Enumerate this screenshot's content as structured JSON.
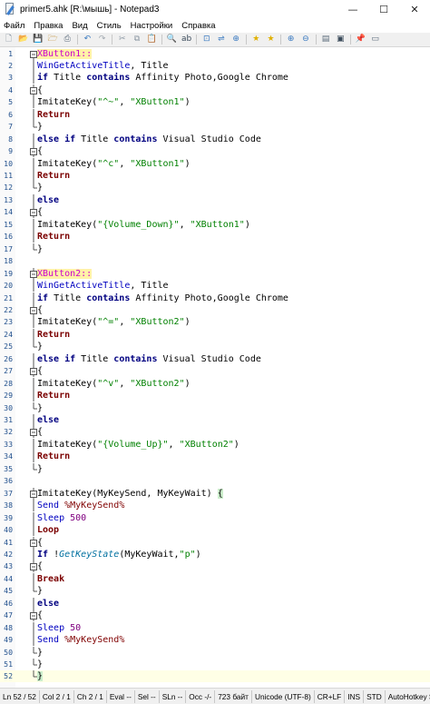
{
  "window": {
    "title": "primer5.ahk [R:\\мышь] - Notepad3"
  },
  "window_controls": {
    "minimize": "—",
    "maximize": "☐",
    "close": "✕"
  },
  "menu": [
    "Файл",
    "Правка",
    "Вид",
    "Стиль",
    "Настройки",
    "Справка"
  ],
  "toolbar": {
    "icons": [
      {
        "name": "new-file-icon",
        "glyph": "🗋",
        "color": "#6a7a8a"
      },
      {
        "name": "open-file-icon",
        "glyph": "📂",
        "color": "#d4a020"
      },
      {
        "name": "save-file-icon",
        "glyph": "💾",
        "color": "#4a6a9a"
      },
      {
        "name": "save-as-icon",
        "glyph": "🗁",
        "color": "#c09030"
      },
      {
        "name": "print-icon",
        "glyph": "⎙",
        "color": "#5a6a7a"
      },
      {
        "name": "sep"
      },
      {
        "name": "undo-icon",
        "glyph": "↶",
        "color": "#3a7ac0"
      },
      {
        "name": "redo-icon",
        "glyph": "↷",
        "color": "#a0a8b0"
      },
      {
        "name": "sep"
      },
      {
        "name": "cut-icon",
        "glyph": "✂",
        "color": "#8a96a2"
      },
      {
        "name": "copy-icon",
        "glyph": "⧉",
        "color": "#8a96a2"
      },
      {
        "name": "paste-icon",
        "glyph": "📋",
        "color": "#c09040"
      },
      {
        "name": "sep"
      },
      {
        "name": "find-icon",
        "glyph": "🔍",
        "color": "#3a4a5a"
      },
      {
        "name": "replace-icon",
        "glyph": "ab",
        "color": "#3a4a5a"
      },
      {
        "name": "sep"
      },
      {
        "name": "goto-icon",
        "glyph": "⊡",
        "color": "#3a7ac0"
      },
      {
        "name": "word-wrap-icon",
        "glyph": "⇌",
        "color": "#3a7ac0"
      },
      {
        "name": "zoom-in-icon",
        "glyph": "⊕",
        "color": "#3a7ac0"
      },
      {
        "name": "sep"
      },
      {
        "name": "favorite-icon",
        "glyph": "★",
        "color": "#e0b000"
      },
      {
        "name": "add-favorite-icon",
        "glyph": "★",
        "color": "#e0b000"
      },
      {
        "name": "sep"
      },
      {
        "name": "zoom-plus-icon",
        "glyph": "⊕",
        "color": "#3a7ac0"
      },
      {
        "name": "zoom-minus-icon",
        "glyph": "⊖",
        "color": "#3a7ac0"
      },
      {
        "name": "sep"
      },
      {
        "name": "scheme-icon",
        "glyph": "▤",
        "color": "#5a6a7a"
      },
      {
        "name": "customize-icon",
        "glyph": "▣",
        "color": "#3a4a5a"
      },
      {
        "name": "sep"
      },
      {
        "name": "pin-icon",
        "glyph": "📌",
        "color": "#3a7ac0"
      },
      {
        "name": "exit-icon",
        "glyph": "▭",
        "color": "#5a6a7a"
      }
    ]
  },
  "editor": {
    "lines": [
      {
        "n": "1",
        "fold": "minus",
        "t": [
          [
            "XButton1::",
            "hot gold"
          ]
        ]
      },
      {
        "n": "2",
        "fold": "line",
        "t": [
          [
            "WinGetActiveTitle",
            "blue"
          ],
          [
            ", Title",
            "plain"
          ]
        ]
      },
      {
        "n": "3",
        "fold": "line",
        "t": [
          [
            "if ",
            "kw"
          ],
          [
            "Title ",
            "plain"
          ],
          [
            "contains ",
            "kw"
          ],
          [
            "Affinity Photo,Google Chrome",
            "plain"
          ]
        ]
      },
      {
        "n": "4",
        "fold": "minus",
        "t": [
          [
            "{",
            "plain"
          ]
        ]
      },
      {
        "n": "5",
        "fold": "line",
        "t": [
          [
            "ImitateKey",
            "plain"
          ],
          [
            "(",
            "plain"
          ],
          [
            "\"^~\"",
            "str"
          ],
          [
            ", ",
            "plain"
          ],
          [
            "\"XButton1\"",
            "str"
          ],
          [
            ")",
            "plain"
          ]
        ]
      },
      {
        "n": "6",
        "fold": "line",
        "t": [
          [
            "Return",
            "ctl"
          ]
        ]
      },
      {
        "n": "7",
        "fold": "end",
        "t": [
          [
            "}",
            "plain"
          ]
        ]
      },
      {
        "n": "8",
        "fold": "line",
        "t": [
          [
            "else if ",
            "kw"
          ],
          [
            "Title ",
            "plain"
          ],
          [
            "contains ",
            "kw"
          ],
          [
            "Visual Studio Code",
            "plain"
          ]
        ]
      },
      {
        "n": "9",
        "fold": "minus",
        "t": [
          [
            "{",
            "plain"
          ]
        ]
      },
      {
        "n": "10",
        "fold": "line",
        "t": [
          [
            "ImitateKey",
            "plain"
          ],
          [
            "(",
            "plain"
          ],
          [
            "\"^c\"",
            "str"
          ],
          [
            ", ",
            "plain"
          ],
          [
            "\"XButton1\"",
            "str"
          ],
          [
            ")",
            "plain"
          ]
        ]
      },
      {
        "n": "11",
        "fold": "line",
        "t": [
          [
            "Return",
            "ctl"
          ]
        ]
      },
      {
        "n": "12",
        "fold": "end",
        "t": [
          [
            "}",
            "plain"
          ]
        ]
      },
      {
        "n": "13",
        "fold": "line",
        "t": [
          [
            "else",
            "kw"
          ]
        ]
      },
      {
        "n": "14",
        "fold": "minus",
        "t": [
          [
            "{",
            "plain"
          ]
        ]
      },
      {
        "n": "15",
        "fold": "line",
        "t": [
          [
            "ImitateKey",
            "plain"
          ],
          [
            "(",
            "plain"
          ],
          [
            "\"{Volume_Down}\"",
            "str"
          ],
          [
            ", ",
            "plain"
          ],
          [
            "\"XButton1\"",
            "str"
          ],
          [
            ")",
            "plain"
          ]
        ]
      },
      {
        "n": "16",
        "fold": "line",
        "t": [
          [
            "Return",
            "ctl"
          ]
        ]
      },
      {
        "n": "17",
        "fold": "end",
        "t": [
          [
            "}",
            "plain"
          ]
        ]
      },
      {
        "n": "18",
        "fold": "none",
        "t": []
      },
      {
        "n": "19",
        "fold": "minus",
        "t": [
          [
            "XButton2::",
            "hot gold"
          ]
        ]
      },
      {
        "n": "20",
        "fold": "line",
        "t": [
          [
            "WinGetActiveTitle",
            "blue"
          ],
          [
            ", Title",
            "plain"
          ]
        ]
      },
      {
        "n": "21",
        "fold": "line",
        "t": [
          [
            "if ",
            "kw"
          ],
          [
            "Title ",
            "plain"
          ],
          [
            "contains ",
            "kw"
          ],
          [
            "Affinity Photo,Google Chrome",
            "plain"
          ]
        ]
      },
      {
        "n": "22",
        "fold": "minus",
        "t": [
          [
            "{",
            "plain"
          ]
        ]
      },
      {
        "n": "23",
        "fold": "line",
        "t": [
          [
            "ImitateKey",
            "plain"
          ],
          [
            "(",
            "plain"
          ],
          [
            "\"^=\"",
            "str"
          ],
          [
            ", ",
            "plain"
          ],
          [
            "\"XButton2\"",
            "str"
          ],
          [
            ")",
            "plain"
          ]
        ]
      },
      {
        "n": "24",
        "fold": "line",
        "t": [
          [
            "Return",
            "ctl"
          ]
        ]
      },
      {
        "n": "25",
        "fold": "end",
        "t": [
          [
            "}",
            "plain"
          ]
        ]
      },
      {
        "n": "26",
        "fold": "line",
        "t": [
          [
            "else if ",
            "kw"
          ],
          [
            "Title ",
            "plain"
          ],
          [
            "contains ",
            "kw"
          ],
          [
            "Visual Studio Code",
            "plain"
          ]
        ]
      },
      {
        "n": "27",
        "fold": "minus",
        "t": [
          [
            "{",
            "plain"
          ]
        ]
      },
      {
        "n": "28",
        "fold": "line",
        "t": [
          [
            "ImitateKey",
            "plain"
          ],
          [
            "(",
            "plain"
          ],
          [
            "\"^v\"",
            "str"
          ],
          [
            ", ",
            "plain"
          ],
          [
            "\"XButton2\"",
            "str"
          ],
          [
            ")",
            "plain"
          ]
        ]
      },
      {
        "n": "29",
        "fold": "line",
        "t": [
          [
            "Return",
            "ctl"
          ]
        ]
      },
      {
        "n": "30",
        "fold": "end",
        "t": [
          [
            "}",
            "plain"
          ]
        ]
      },
      {
        "n": "31",
        "fold": "line",
        "t": [
          [
            "else",
            "kw"
          ]
        ]
      },
      {
        "n": "32",
        "fold": "minus",
        "t": [
          [
            "{",
            "plain"
          ]
        ]
      },
      {
        "n": "33",
        "fold": "line",
        "t": [
          [
            "ImitateKey",
            "plain"
          ],
          [
            "(",
            "plain"
          ],
          [
            "\"{Volume_Up}\"",
            "str"
          ],
          [
            ", ",
            "plain"
          ],
          [
            "\"XButton2\"",
            "str"
          ],
          [
            ")",
            "plain"
          ]
        ]
      },
      {
        "n": "34",
        "fold": "line",
        "t": [
          [
            "Return",
            "ctl"
          ]
        ]
      },
      {
        "n": "35",
        "fold": "end",
        "t": [
          [
            "}",
            "plain"
          ]
        ]
      },
      {
        "n": "36",
        "fold": "none",
        "t": []
      },
      {
        "n": "37",
        "fold": "minus",
        "t": [
          [
            "ImitateKey",
            "plain"
          ],
          [
            "(MyKeySend, MyKeyWait) ",
            "plain"
          ],
          [
            "{",
            "plain bracehl"
          ]
        ]
      },
      {
        "n": "38",
        "fold": "line",
        "t": [
          [
            "Send ",
            "blue"
          ],
          [
            "%MyKeySend%",
            "var"
          ]
        ]
      },
      {
        "n": "39",
        "fold": "line",
        "t": [
          [
            "Sleep ",
            "blue"
          ],
          [
            "500",
            "num"
          ]
        ]
      },
      {
        "n": "40",
        "fold": "line",
        "t": [
          [
            "Loop",
            "ctl"
          ]
        ]
      },
      {
        "n": "41",
        "fold": "minus",
        "t": [
          [
            "{",
            "plain"
          ]
        ]
      },
      {
        "n": "42",
        "fold": "line",
        "t": [
          [
            "If ",
            "kw"
          ],
          [
            "!",
            "plain"
          ],
          [
            "GetKeyState",
            "italic"
          ],
          [
            "(MyKeyWait,",
            "plain"
          ],
          [
            "\"p\"",
            "str"
          ],
          [
            ")",
            "plain"
          ]
        ]
      },
      {
        "n": "43",
        "fold": "minus",
        "t": [
          [
            "{",
            "plain"
          ]
        ]
      },
      {
        "n": "44",
        "fold": "line",
        "t": [
          [
            "Break",
            "ctl"
          ]
        ]
      },
      {
        "n": "45",
        "fold": "end",
        "t": [
          [
            "}",
            "plain"
          ]
        ]
      },
      {
        "n": "46",
        "fold": "line",
        "t": [
          [
            "else",
            "kw"
          ]
        ]
      },
      {
        "n": "47",
        "fold": "minus",
        "t": [
          [
            "{",
            "plain"
          ]
        ]
      },
      {
        "n": "48",
        "fold": "line",
        "t": [
          [
            "Sleep ",
            "blue"
          ],
          [
            "50",
            "num"
          ]
        ]
      },
      {
        "n": "49",
        "fold": "line",
        "t": [
          [
            "Send ",
            "blue"
          ],
          [
            "%MyKeySend%",
            "var"
          ]
        ]
      },
      {
        "n": "50",
        "fold": "end",
        "t": [
          [
            "}",
            "plain"
          ]
        ]
      },
      {
        "n": "51",
        "fold": "end",
        "t": [
          [
            "}",
            "plain"
          ]
        ]
      },
      {
        "n": "52",
        "fold": "end",
        "current": true,
        "t": [
          [
            "}",
            "plain bracehl"
          ]
        ]
      }
    ]
  },
  "statusbar": {
    "items": [
      "Ln 52 / 52",
      "Col 2 / 1",
      "Ch 2 / 1",
      "Eval --",
      "Sel --",
      "SLn --",
      "Occ -/-",
      "723 байт",
      "Unicode (UTF-8)",
      "CR+LF",
      "INS",
      "STD",
      "AutoHotkey Script"
    ]
  }
}
